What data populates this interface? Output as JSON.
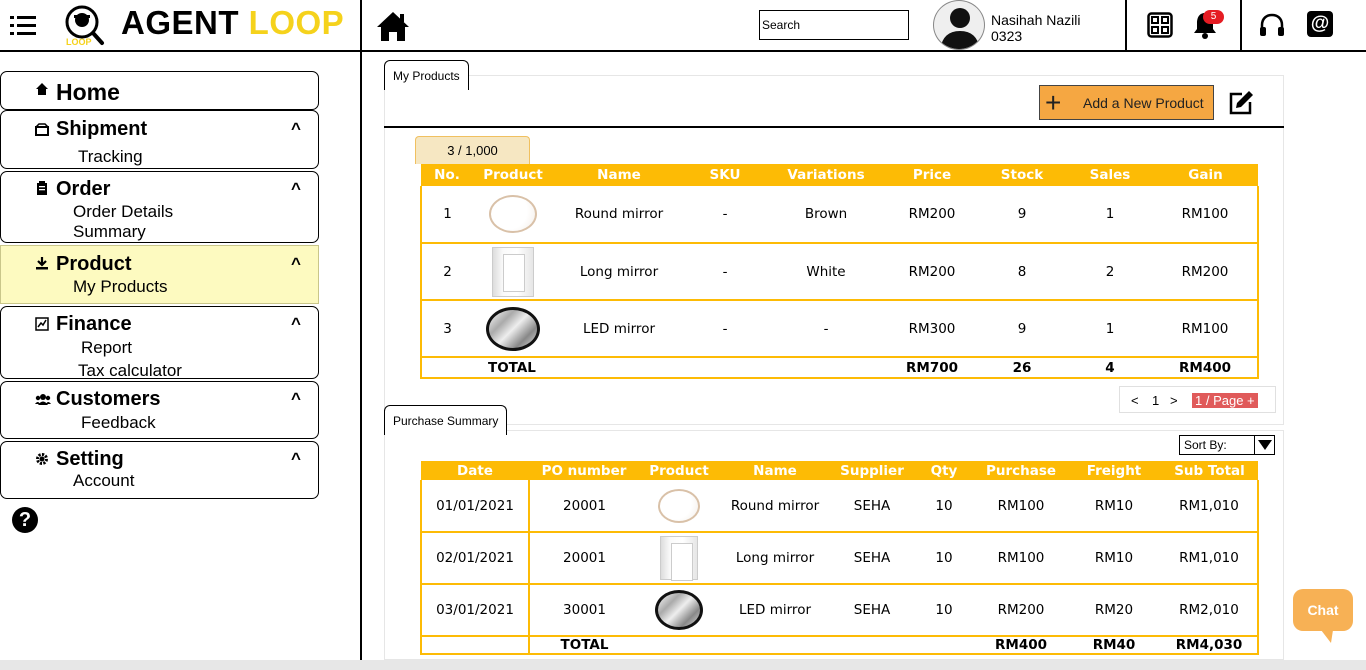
{
  "app": {
    "name_part1": "AGENT ",
    "name_part2": "LOOP",
    "badge_text": "LOOP"
  },
  "header": {
    "search_placeholder": "Search",
    "user_name": "Nasihah Nazili",
    "user_id": "0323",
    "notification_count": "5"
  },
  "sidebar": {
    "home": "Home",
    "shipment": {
      "label": "Shipment",
      "caret": "^",
      "items": [
        "Tracking"
      ]
    },
    "order": {
      "label": "Order",
      "caret": "^",
      "items": [
        "Order Details",
        "Summary"
      ]
    },
    "product": {
      "label": "Product",
      "caret": "^",
      "items": [
        "My Products"
      ]
    },
    "finance": {
      "label": "Finance",
      "caret": "^",
      "items": [
        "Report",
        "Tax calculator"
      ]
    },
    "customers": {
      "label": "Customers",
      "caret": "^",
      "items": [
        "Feedback"
      ]
    },
    "setting": {
      "label": "Setting",
      "caret": "^",
      "items": [
        "Account"
      ]
    },
    "help": "?"
  },
  "products": {
    "tab": "My Products",
    "add_button": "Add a New Product",
    "count": "3  /  1,000",
    "columns": [
      "No.",
      "Product",
      "Name",
      "SKU",
      "Variations",
      "Price",
      "Stock",
      "Sales",
      "Gain"
    ],
    "rows": [
      {
        "no": "1",
        "img": "round",
        "name": "Round mirror",
        "sku": "-",
        "variation": "Brown",
        "price": "RM200",
        "stock": "9",
        "sales": "1",
        "gain": "RM100"
      },
      {
        "no": "2",
        "img": "long",
        "name": "Long mirror",
        "sku": "-",
        "variation": "White",
        "price": "RM200",
        "stock": "8",
        "sales": "2",
        "gain": "RM200"
      },
      {
        "no": "3",
        "img": "led",
        "name": "LED mirror",
        "sku": "-",
        "variation": "-",
        "price": "RM300",
        "stock": "9",
        "sales": "1",
        "gain": "RM100"
      }
    ],
    "total": {
      "label": "TOTAL",
      "price": "RM700",
      "stock": "26",
      "sales": "4",
      "gain": "RM400"
    },
    "pager": {
      "prev": "<",
      "page": "1",
      "next": ">",
      "per_page": "1 / Page +"
    }
  },
  "purchases": {
    "tab": "Purchase Summary",
    "sort_label": "Sort By:",
    "columns": [
      "Date",
      "PO number",
      "Product",
      "Name",
      "Supplier",
      "Qty",
      "Purchase",
      "Freight",
      "Sub Total"
    ],
    "rows": [
      {
        "date": "01/01/2021",
        "po": "20001",
        "img": "round",
        "name": "Round mirror",
        "supplier": "SEHA",
        "qty": "10",
        "purchase": "RM100",
        "freight": "RM10",
        "subtotal": "RM1,010"
      },
      {
        "date": "02/01/2021",
        "po": "20001",
        "img": "long",
        "name": "Long mirror",
        "supplier": "SEHA",
        "qty": "10",
        "purchase": "RM100",
        "freight": "RM10",
        "subtotal": "RM1,010"
      },
      {
        "date": "03/01/2021",
        "po": "30001",
        "img": "led",
        "name": "LED mirror",
        "supplier": "SEHA",
        "qty": "10",
        "purchase": "RM200",
        "freight": "RM20",
        "subtotal": "RM2,010"
      }
    ],
    "total": {
      "label": "TOTAL",
      "purchase": "RM400",
      "freight": "RM40",
      "subtotal": "RM4,030"
    }
  },
  "chat": {
    "label": "Chat"
  },
  "colors": {
    "accent": "#fdbb05",
    "brand_yellow": "#f5d21c",
    "button_orange": "#f5a742",
    "active_nav": "#fdfac0"
  }
}
